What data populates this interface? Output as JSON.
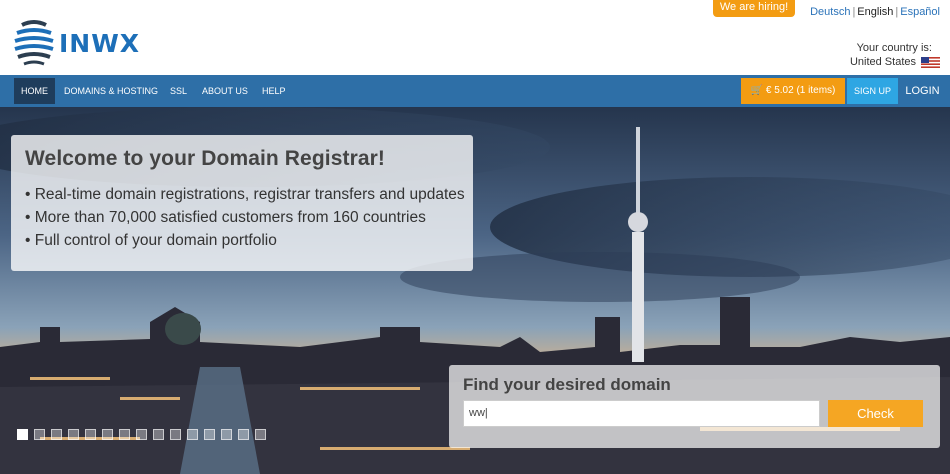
{
  "brand": {
    "logo_text": "INWX"
  },
  "header": {
    "hiring_label": "We are hiring!",
    "languages": [
      {
        "label": "Deutsch",
        "current": false
      },
      {
        "label": "English",
        "current": true
      },
      {
        "label": "Español",
        "current": false
      }
    ],
    "country_label": "Your country is:",
    "country_value": "United States"
  },
  "nav": {
    "items": [
      {
        "label": "HOME",
        "active": true
      },
      {
        "label": "DOMAINS & HOSTING",
        "active": false
      },
      {
        "label": "SSL",
        "active": false
      },
      {
        "label": "ABOUT US",
        "active": false
      },
      {
        "label": "HELP",
        "active": false
      }
    ],
    "cart_label": "€ 5.02 (1 items)",
    "signup_label": "SIGN UP",
    "login_label": "LOGIN"
  },
  "hero": {
    "title": "Welcome to your Domain Registrar!",
    "bullets": [
      "Real-time domain registrations, registrar transfers and updates",
      "More than 70,000 satisfied customers from 160 countries",
      "Full control of your domain portfolio"
    ]
  },
  "domain_search": {
    "title": "Find your desired domain",
    "value": "ww|",
    "button_label": "Check"
  },
  "slider": {
    "count": 15,
    "active_index": 0
  },
  "colors": {
    "brand_blue": "#1d6fb8",
    "nav_bg": "#2e6fa7",
    "accent_orange": "#f39c12",
    "signup_blue": "#2ea6e3"
  }
}
